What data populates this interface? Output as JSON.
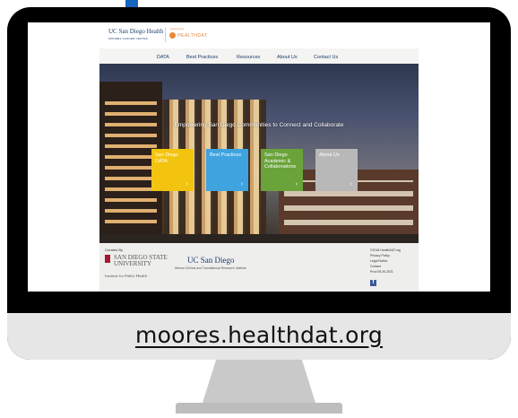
{
  "device": {
    "url_caption": "moores.healthdat.org"
  },
  "site": {
    "logo_primary": "UC San Diego Health",
    "logo_primary_sub": "MOORES CANCER CENTER",
    "logo_secondary_top": "powered by",
    "logo_secondary": "HEALTHDAT",
    "nav": [
      "DATA",
      "Best Practices",
      "Resources",
      "About Us",
      "Contact Us"
    ],
    "hero_title": "Empowering San Diego Communities to Connect and Collaborate",
    "tiles": [
      {
        "label": "San Diego DATA",
        "color": "#f2c40f"
      },
      {
        "label": "Best Practices",
        "color": "#3fa3e0"
      },
      {
        "label": "San Diego Academic & Collaborations",
        "color": "#6aa33a"
      },
      {
        "label": "About Us",
        "color": "#b8b8b8"
      }
    ],
    "tile_chevron": "›",
    "footer": {
      "created_by": "Created By",
      "sdsu_line1": "SAN DIEGO STATE",
      "sdsu_line2": "UNIVERSITY",
      "ucsd": "UC San Diego",
      "altman": "Altman Clinical and Translational Research Institute",
      "iph": "Institute for Public Health",
      "copyright": "©2018 HealthDAT.org",
      "privacy": "Privacy Policy",
      "legal": "Legal Notice",
      "contact": "Contact",
      "posted": "Prod 05.26.2021",
      "facebook_icon": "f"
    }
  }
}
